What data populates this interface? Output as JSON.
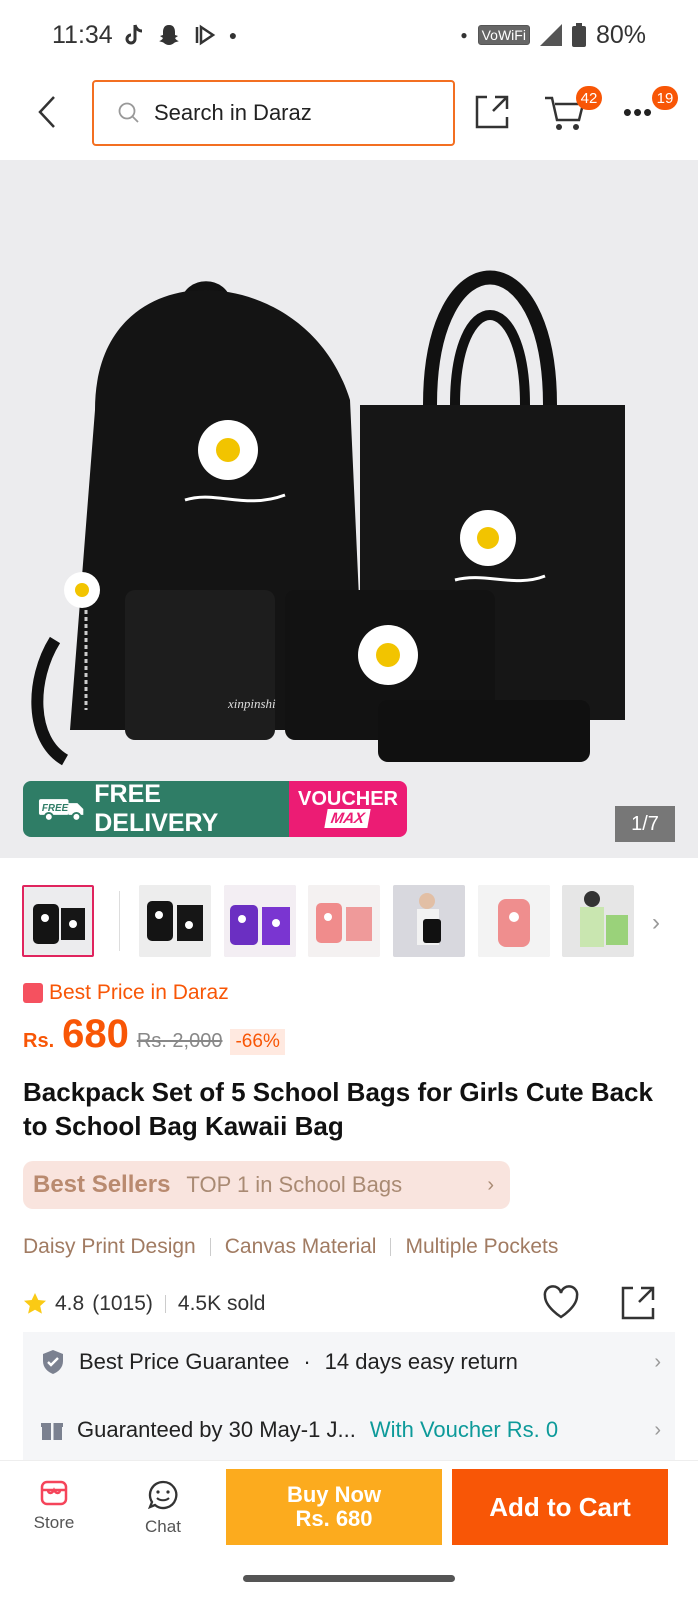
{
  "status_bar": {
    "time": "11:34",
    "battery": "80%",
    "network": "VoWiFi"
  },
  "header": {
    "search_placeholder": "Search in Daraz",
    "cart_count": "42",
    "menu_count": "19"
  },
  "hero": {
    "promo_left": "FREE DELIVERY",
    "promo_free_tag": "FREE",
    "promo_right_top": "VOUCHER",
    "promo_right_bottom": "MAX",
    "image_counter": "1/7",
    "print_text": "xinpinshi"
  },
  "price": {
    "badge_text": "Best Price in Daraz",
    "currency": "Rs.",
    "amount": "680",
    "original": "Rs. 2,000",
    "discount": "-66%"
  },
  "product": {
    "title": "Backpack Set of 5 School Bags for Girls Cute Back to School Bag Kawaii Bag"
  },
  "best_sellers": {
    "label": "Best Sellers",
    "text": "TOP 1 in School Bags"
  },
  "features": [
    "Daisy Print Design",
    "Canvas Material",
    "Multiple Pockets"
  ],
  "rating": {
    "score": "4.8",
    "count": "(1015)",
    "sold": "4.5K sold"
  },
  "info": {
    "guarantee": "Best Price Guarantee",
    "dot": "·",
    "return": "14 days easy return",
    "delivery": "Guaranteed by 30 May-1 J...",
    "voucher": "With Voucher Rs. 0"
  },
  "bottom_bar": {
    "store": "Store",
    "chat": "Chat",
    "buy_now": "Buy Now",
    "buy_price": "Rs. 680",
    "add_to_cart": "Add to Cart"
  },
  "colors": {
    "accent": "#f85606",
    "buy_now": "#fcab1e",
    "voucher": "#0d9a9a",
    "search_border": "#f36f21"
  }
}
